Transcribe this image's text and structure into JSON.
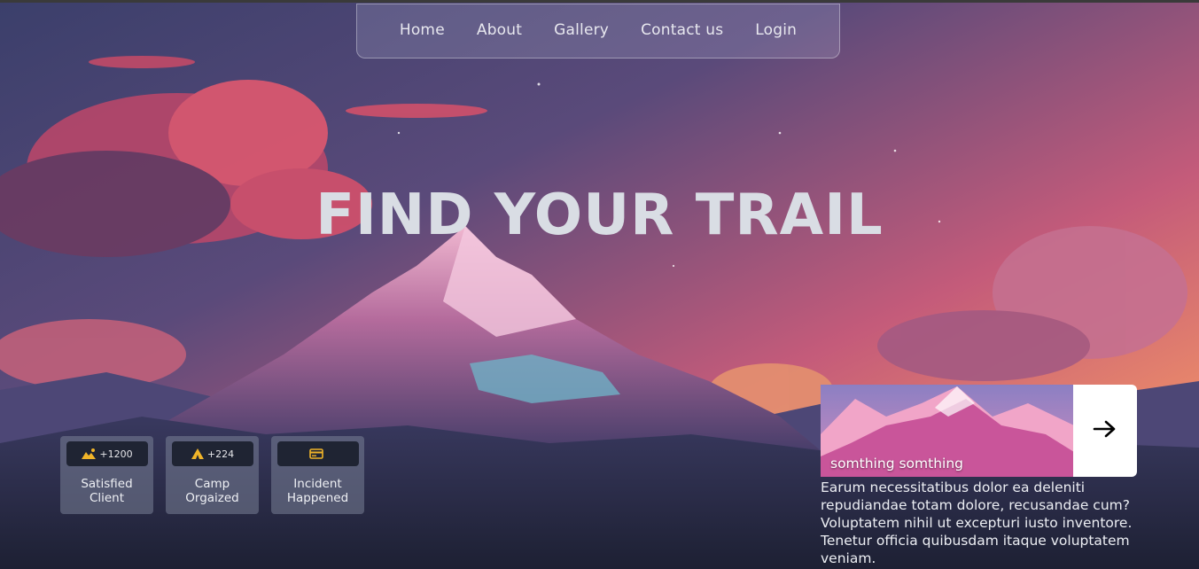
{
  "nav": {
    "items": [
      {
        "label": "Home"
      },
      {
        "label": "About"
      },
      {
        "label": "Gallery"
      },
      {
        "label": "Contact us"
      },
      {
        "label": "Login"
      }
    ]
  },
  "hero": {
    "title": "FIND YOUR TRAIL"
  },
  "stats": [
    {
      "icon": "mountain-icon",
      "count": "+1200",
      "label_line1": "Satisfied",
      "label_line2": "Client"
    },
    {
      "icon": "tent-icon",
      "count": "+224",
      "label_line1": "Camp",
      "label_line2": "Orgaized"
    },
    {
      "icon": "card-icon",
      "count": "",
      "label_line1": "Incident",
      "label_line2": "Happened"
    }
  ],
  "card": {
    "caption": "somthing somthing",
    "body": "Earum necessitatibus dolor ea deleniti repudiandae totam dolore, recusandae cum? Voluptatem nihil ut excepturi iusto inventore. Tenetur officia quibusdam itaque voluptatem veniam."
  },
  "colors": {
    "icon_accent": "#f0b429",
    "nav_text": "#e8e8ef",
    "title": "#d9dde4",
    "arrow_bg": "#ffffff"
  }
}
